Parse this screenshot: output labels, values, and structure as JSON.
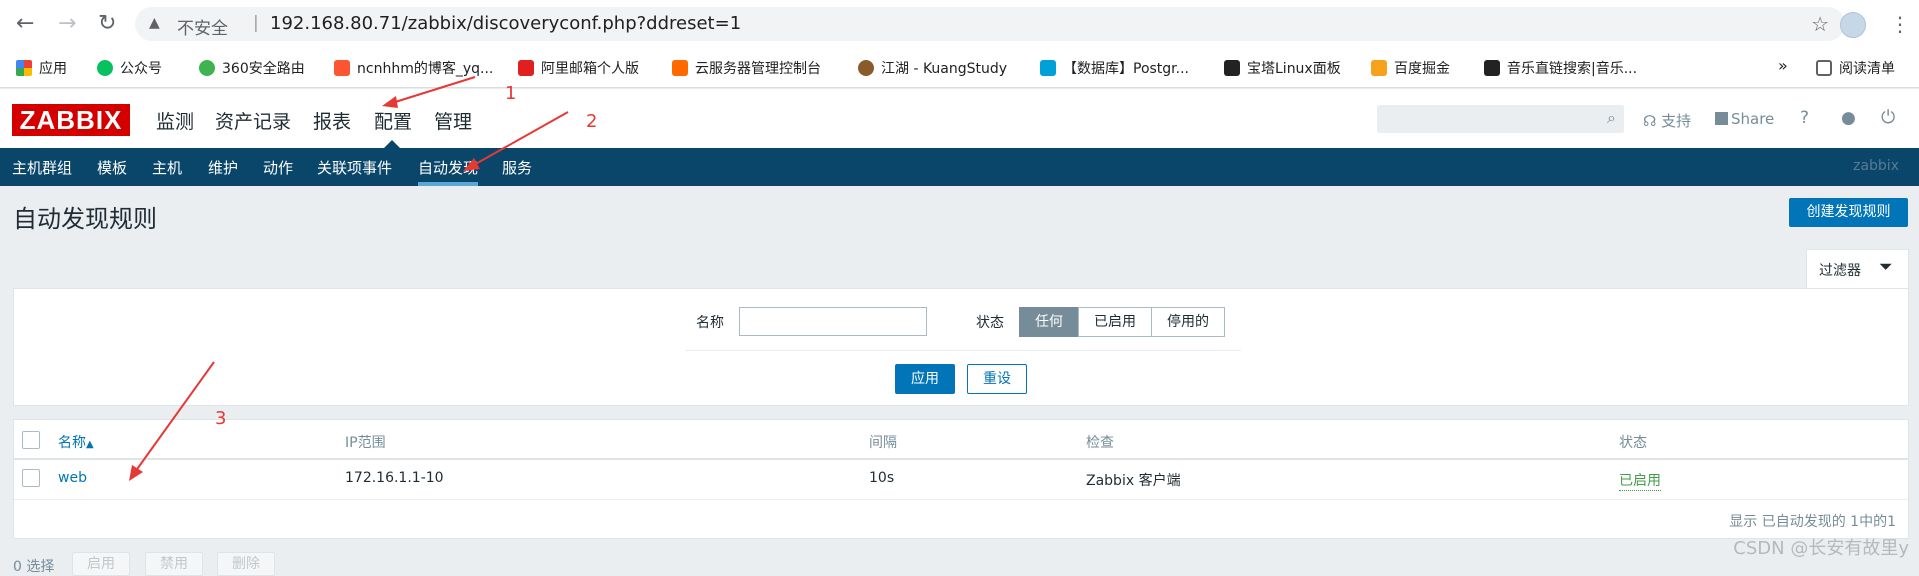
{
  "browser": {
    "url_insecure_label": "不安全",
    "url_sep": "|",
    "url": "192.168.80.71/zabbix/discoveryconf.php?ddreset=1",
    "bookmarks": [
      {
        "label": "应用",
        "color": "#e94235"
      },
      {
        "label": "公众号",
        "color": "#07c160"
      },
      {
        "label": "360安全路由",
        "color": "#3fb34f"
      },
      {
        "label": "ncnhhm的博客_yq...",
        "color": "#fc5531"
      },
      {
        "label": "阿里邮箱个人版",
        "color": "#e02020"
      },
      {
        "label": "云服务器管理控制台",
        "color": "#ff6a00"
      },
      {
        "label": "江湖 - KuangStudy",
        "color": "#8b5a2b"
      },
      {
        "label": "【数据库】Postgr...",
        "color": "#00a1d6"
      },
      {
        "label": "宝塔Linux面板",
        "color": "#222222"
      },
      {
        "label": "百度掘金",
        "color": "#f7a21b"
      },
      {
        "label": "音乐直链搜索|音乐...",
        "color": "#222222"
      }
    ],
    "bookmarks_more": "»",
    "reading_list": "阅读清单"
  },
  "header": {
    "logo": "ZABBIX",
    "menu": [
      "监测",
      "资产记录",
      "报表",
      "配置",
      "管理"
    ],
    "support": "支持",
    "share": "Share",
    "help": "?"
  },
  "submenu": {
    "items": [
      "主机群组",
      "模板",
      "主机",
      "维护",
      "动作",
      "关联项事件",
      "自动发现",
      "服务"
    ],
    "brand": "zabbix"
  },
  "page": {
    "title": "自动发现规则",
    "create_button": "创建发现规则"
  },
  "filter": {
    "tab_label": "过滤器",
    "name_label": "名称",
    "name_value": "",
    "status_label": "状态",
    "status_options": [
      "任何",
      "已启用",
      "停用的"
    ],
    "status_selected": "任何",
    "apply": "应用",
    "reset": "重设"
  },
  "table": {
    "headers": {
      "name": "名称",
      "sort_indicator": "▲",
      "ip_range": "IP范围",
      "interval": "间隔",
      "checks": "检查",
      "status": "状态"
    },
    "rows": [
      {
        "name": "web",
        "ip_range": "172.16.1.1-10",
        "interval": "10s",
        "checks": "Zabbix 客户端",
        "status": "已启用"
      }
    ],
    "footer": "显示 已自动发现的 1中的1"
  },
  "actions": {
    "selected": "0 选择",
    "buttons": [
      "启用",
      "禁用",
      "删除"
    ]
  },
  "annotations": [
    "1",
    "2",
    "3"
  ],
  "watermark": "CSDN @长安有故里y"
}
